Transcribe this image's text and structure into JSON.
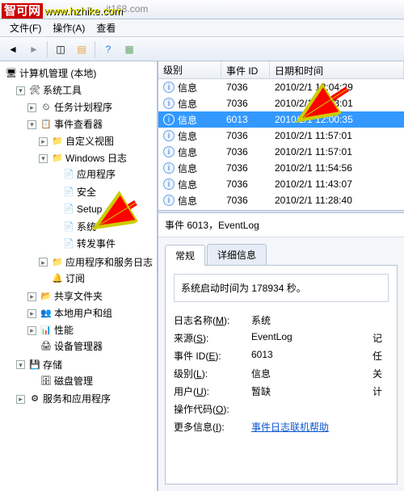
{
  "watermark": {
    "zh": "智可网",
    "url": "www.hzhike.com",
    "faint": ".it168.com"
  },
  "menu": {
    "file": "文件(F)",
    "action": "操作(A)",
    "view": "查看"
  },
  "tree": {
    "root": "计算机管理 (本地)",
    "sys_tools": "系统工具",
    "task_sched": "任务计划程序",
    "event_viewer": "事件查看器",
    "custom_views": "自定义视图",
    "win_logs": "Windows 日志",
    "app_log": "应用程序",
    "security": "安全",
    "setup": "Setup",
    "system": "系统",
    "forwarded": "转发事件",
    "app_svc_logs": "应用程序和服务日志",
    "subscriptions": "订阅",
    "shared": "共享文件夹",
    "users": "本地用户和组",
    "perf": "性能",
    "devmgr": "设备管理器",
    "storage": "存储",
    "diskmgmt": "磁盘管理",
    "svc_apps": "服务和应用程序"
  },
  "grid": {
    "headers": {
      "level": "级别",
      "event_id": "事件 ID",
      "datetime": "日期和时间"
    },
    "level_info": "信息",
    "rows": [
      {
        "eid": "7036",
        "dt": "2010/2/1 12:04:29",
        "sel": false
      },
      {
        "eid": "7036",
        "dt": "2010/2/1 12:03:01",
        "sel": false
      },
      {
        "eid": "6013",
        "dt": "2010/2/1 12:00:35",
        "sel": true
      },
      {
        "eid": "7036",
        "dt": "2010/2/1 11:57:01",
        "sel": false
      },
      {
        "eid": "7036",
        "dt": "2010/2/1 11:57:01",
        "sel": false
      },
      {
        "eid": "7036",
        "dt": "2010/2/1 11:54:56",
        "sel": false
      },
      {
        "eid": "7036",
        "dt": "2010/2/1 11:43:07",
        "sel": false
      },
      {
        "eid": "7036",
        "dt": "2010/2/1 11:28:40",
        "sel": false
      }
    ]
  },
  "detail": {
    "title": "事件 6013，EventLog",
    "tabs": {
      "general": "常规",
      "details": "详细信息"
    },
    "message": "系统启动时间为 178934 秒。",
    "fields": {
      "log_name_k": "日志名称",
      "log_name_u": "M",
      "log_name_v": "系统",
      "source_k": "来源",
      "source_u": "S",
      "source_v": "EventLog",
      "recorded_k": "记",
      "event_id_k": "事件 ID",
      "event_id_u": "E",
      "event_id_v": "6013",
      "task_k": "任",
      "level_k": "级别",
      "level_u": "L",
      "level_v": "信息",
      "keywords_k": "关",
      "user_k": "用户",
      "user_u": "U",
      "user_v": "暂缺",
      "computer_k": "计",
      "opcode_k": "操作代码",
      "opcode_u": "O",
      "more_k": "更多信息",
      "more_u": "I",
      "more_link": "事件日志联机帮助"
    }
  }
}
